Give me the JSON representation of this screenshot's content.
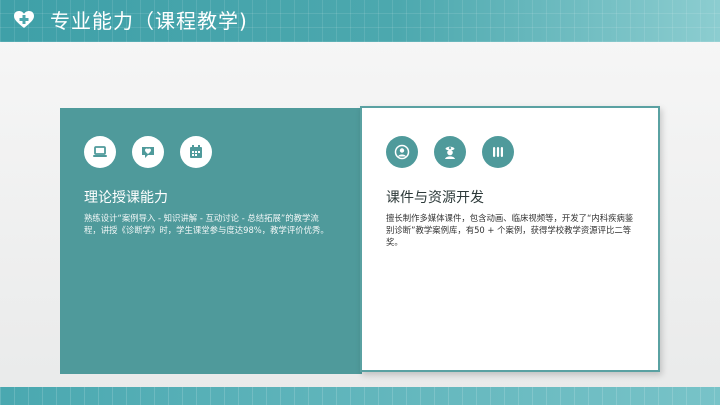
{
  "header": {
    "title": "专业能力（课程教学)",
    "icon": "heart-plus-icon"
  },
  "cards": [
    {
      "title": "理论授课能力",
      "text": "熟练设计“案例导入 - 知识讲解 - 互动讨论 - 总结拓展”的教学流程，讲授《诊断学》时，学生课堂参与度达98%，教学评价优秀。",
      "icons": [
        "laptop-icon",
        "chat-heart-icon",
        "calendar-icon"
      ]
    },
    {
      "title": "课件与资源开发",
      "text": "擅长制作多媒体课件，包含动画、临床视频等，开发了“内科疾病鉴别诊断”教学案例库，有50 + 个案例，获得学校教学资源评比二等奖。",
      "icons": [
        "doctor-icon",
        "nurse-icon",
        "test-tubes-icon"
      ]
    }
  ],
  "colors": {
    "accent": "#4f9a9b",
    "header": "#4ca8ae"
  }
}
